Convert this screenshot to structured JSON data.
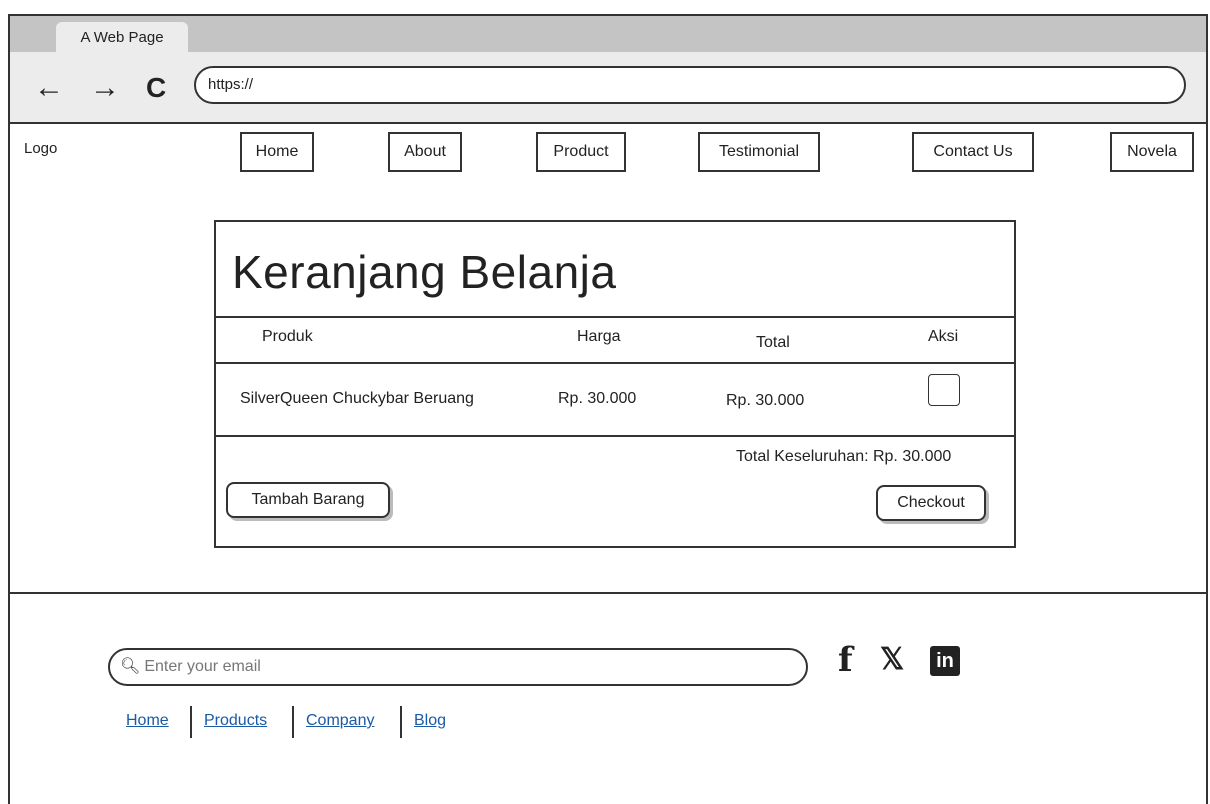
{
  "browser": {
    "tab_title": "A Web Page",
    "url": "https://",
    "back_icon": "←",
    "forward_icon": "→",
    "reload_icon": "C"
  },
  "header": {
    "logo": "Logo",
    "nav": [
      "Home",
      "About",
      "Product",
      "Testimonial",
      "Contact Us",
      "Novela"
    ]
  },
  "cart": {
    "title": "Keranjang Belanja",
    "columns": [
      "Produk",
      "Harga",
      "Total",
      "Aksi"
    ],
    "rows": [
      {
        "product": "SilverQueen Chuckybar Beruang",
        "price": "Rp. 30.000",
        "total": "Rp. 30.000"
      }
    ],
    "grand_total": "Total Keseluruhan: Rp. 30.000",
    "add_button": "Tambah Barang",
    "checkout_button": "Checkout"
  },
  "footer": {
    "email_placeholder": "Enter your email",
    "social": {
      "facebook": "f",
      "x": "𝕏",
      "linkedin": "in"
    },
    "links": [
      "Home",
      "Products",
      "Company",
      "Blog"
    ]
  },
  "colors": {
    "link": "#1a5aa6",
    "tabbar": "#c4c4c4",
    "addressbar": "#ececec"
  }
}
